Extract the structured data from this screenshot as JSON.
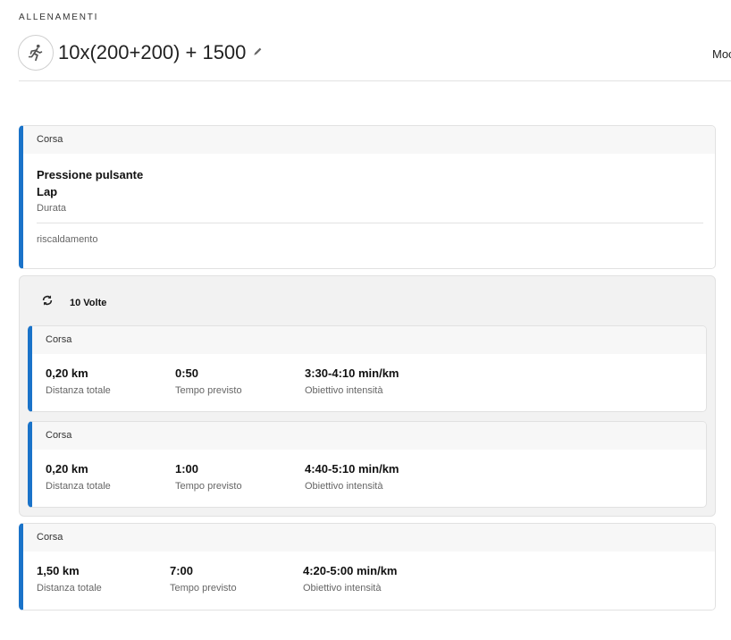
{
  "header": {
    "breadcrumb": "ALLENAMENTI",
    "title": "10x(200+200) + 1500",
    "modify_label": "Moc",
    "icons": {
      "workout": "running-person-icon",
      "edit": "pencil-icon"
    }
  },
  "warmup": {
    "type": "Corsa",
    "line1": "Pressione pulsante",
    "line2": "Lap",
    "line3": "Durata",
    "note": "riscaldamento"
  },
  "repeat": {
    "icon": "repeat-icon",
    "label": "10 Volte",
    "steps": [
      {
        "type": "Corsa",
        "distance": "0,20 km",
        "distance_label": "Distanza totale",
        "time": "0:50",
        "time_label": "Tempo previsto",
        "target": "3:30-4:10 min/km",
        "target_label": "Obiettivo intensità"
      },
      {
        "type": "Corsa",
        "distance": "0,20 km",
        "distance_label": "Distanza totale",
        "time": "1:00",
        "time_label": "Tempo previsto",
        "target": "4:40-5:10 min/km",
        "target_label": "Obiettivo intensità"
      }
    ]
  },
  "cooldown": {
    "type": "Corsa",
    "distance": "1,50 km",
    "distance_label": "Distanza totale",
    "time": "7:00",
    "time_label": "Tempo previsto",
    "target": "4:20-5:00 min/km",
    "target_label": "Obiettivo intensità"
  },
  "colors": {
    "accent": "#1a73c9",
    "card_header_bg": "#f7f7f7",
    "repeat_bg": "#f2f2f2",
    "border": "#e1e1e1"
  }
}
